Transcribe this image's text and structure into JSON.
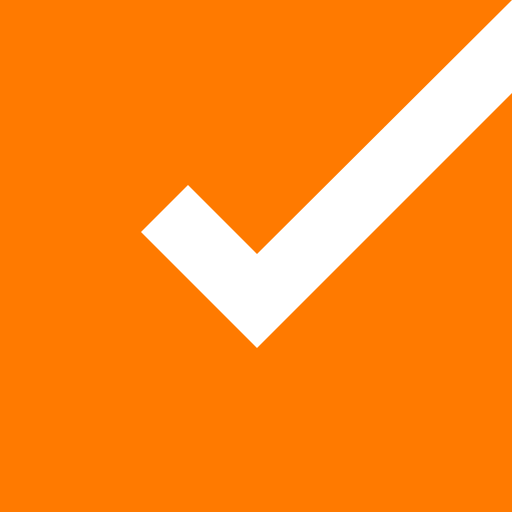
{
  "app": {
    "background_color": "#FF7A00",
    "icon": {
      "name": "checkmark-icon",
      "color": "#FFFFFF"
    }
  }
}
